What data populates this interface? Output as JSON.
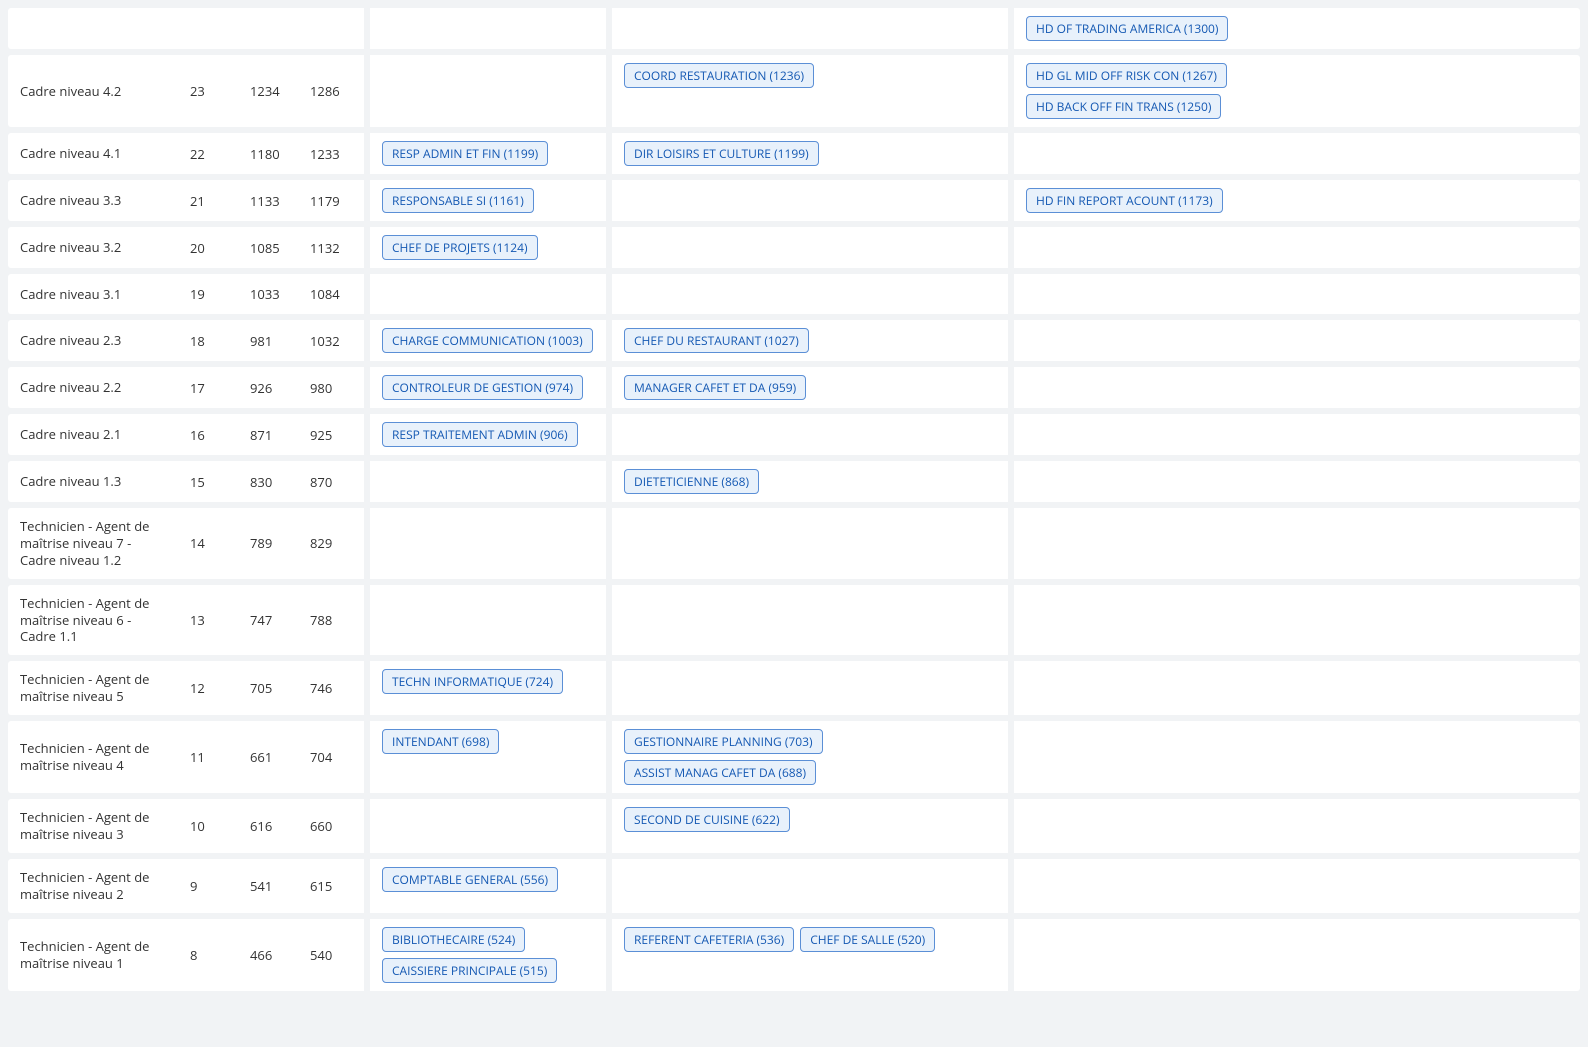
{
  "rows": [
    {
      "label": "",
      "n1": "",
      "n2": "",
      "n3": "",
      "tags1": [],
      "tags2": [],
      "tags3": [
        "HD OF TRADING AMERICA (1300)"
      ]
    },
    {
      "label": "Cadre niveau 4.2",
      "n1": "23",
      "n2": "1234",
      "n3": "1286",
      "tags1": [],
      "tags2": [
        "COORD RESTAURATION (1236)"
      ],
      "tags3": [
        "HD GL MID OFF RISK CON (1267)",
        "HD BACK OFF FIN TRANS (1250)"
      ]
    },
    {
      "label": "Cadre niveau 4.1",
      "n1": "22",
      "n2": "1180",
      "n3": "1233",
      "tags1": [
        "RESP ADMIN ET FIN (1199)"
      ],
      "tags2": [
        "DIR LOISIRS ET CULTURE (1199)"
      ],
      "tags3": []
    },
    {
      "label": "Cadre niveau 3.3",
      "n1": "21",
      "n2": "1133",
      "n3": "1179",
      "tags1": [
        "RESPONSABLE SI (1161)"
      ],
      "tags2": [],
      "tags3": [
        "HD FIN REPORT ACOUNT (1173)"
      ]
    },
    {
      "label": "Cadre niveau 3.2",
      "n1": "20",
      "n2": "1085",
      "n3": "1132",
      "tags1": [
        "CHEF DE PROJETS (1124)"
      ],
      "tags2": [],
      "tags3": []
    },
    {
      "label": "Cadre niveau 3.1",
      "n1": "19",
      "n2": "1033",
      "n3": "1084",
      "tags1": [],
      "tags2": [],
      "tags3": []
    },
    {
      "label": "Cadre niveau 2.3",
      "n1": "18",
      "n2": "981",
      "n3": "1032",
      "tags1": [
        "CHARGE COMMUNICATION (1003)"
      ],
      "tags2": [
        "CHEF DU RESTAURANT (1027)"
      ],
      "tags3": []
    },
    {
      "label": "Cadre niveau 2.2",
      "n1": "17",
      "n2": "926",
      "n3": "980",
      "tags1": [
        "CONTROLEUR DE GESTION (974)"
      ],
      "tags2": [
        "MANAGER CAFET ET DA (959)"
      ],
      "tags3": []
    },
    {
      "label": "Cadre niveau 2.1",
      "n1": "16",
      "n2": "871",
      "n3": "925",
      "tags1": [
        "RESP TRAITEMENT ADMIN (906)"
      ],
      "tags2": [],
      "tags3": []
    },
    {
      "label": "Cadre niveau 1.3",
      "n1": "15",
      "n2": "830",
      "n3": "870",
      "tags1": [],
      "tags2": [
        "DIETETICIENNE (868)"
      ],
      "tags3": []
    },
    {
      "label": "Technicien - Agent de maîtrise niveau 7 - Cadre niveau 1.2",
      "n1": "14",
      "n2": "789",
      "n3": "829",
      "tags1": [],
      "tags2": [],
      "tags3": []
    },
    {
      "label": "Technicien - Agent de maîtrise niveau 6 - Cadre 1.1",
      "n1": "13",
      "n2": "747",
      "n3": "788",
      "tags1": [],
      "tags2": [],
      "tags3": []
    },
    {
      "label": "Technicien - Agent de maîtrise niveau 5",
      "n1": "12",
      "n2": "705",
      "n3": "746",
      "tags1": [
        "TECHN INFORMATIQUE (724)"
      ],
      "tags2": [],
      "tags3": []
    },
    {
      "label": "Technicien - Agent de maîtrise niveau 4",
      "n1": "11",
      "n2": "661",
      "n3": "704",
      "tags1": [
        "INTENDANT (698)"
      ],
      "tags2": [
        "GESTIONNAIRE PLANNING (703)",
        "ASSIST MANAG CAFET DA (688)"
      ],
      "tags3": []
    },
    {
      "label": "Technicien - Agent de maîtrise niveau 3",
      "n1": "10",
      "n2": "616",
      "n3": "660",
      "tags1": [],
      "tags2": [
        "SECOND DE CUISINE (622)"
      ],
      "tags3": []
    },
    {
      "label": "Technicien - Agent de maîtrise niveau 2",
      "n1": "9",
      "n2": "541",
      "n3": "615",
      "tags1": [
        "COMPTABLE GENERAL (556)"
      ],
      "tags2": [],
      "tags3": []
    },
    {
      "label": "Technicien - Agent de maîtrise niveau 1",
      "n1": "8",
      "n2": "466",
      "n3": "540",
      "tags1": [
        "BIBLIOTHECAIRE (524)",
        "CAISSIERE PRINCIPALE (515)"
      ],
      "tags2": [
        "REFERENT CAFETERIA (536)",
        "CHEF DE SALLE (520)"
      ],
      "tags3": []
    }
  ]
}
